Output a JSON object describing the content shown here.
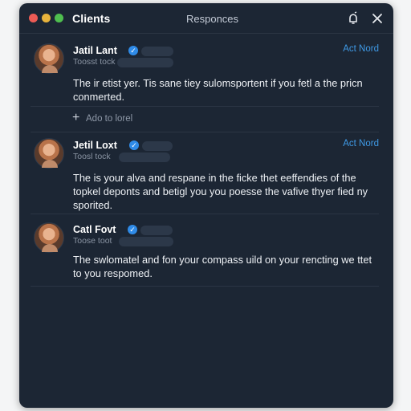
{
  "window": {
    "app_title": "Clients",
    "center_title": "Responces",
    "refresh_icon": "bell-icon",
    "close_icon": "close-icon"
  },
  "posts": [
    {
      "name": "Jatil Lant",
      "handle": "Toosst tock",
      "action": "Act Nord",
      "text": "The ir etist yer. Tis sane tiey sulomsportent if you fetl a the pricn conmerted."
    },
    {
      "name": "Jetil Loxt",
      "handle": "Toosl tock",
      "action": "Act Nord",
      "text": "The is your alva and respane in the ficke thet eeffendies of the topkel deponts and betigl you you poesse the vafive thyer fied ny sporited."
    },
    {
      "name": "Catl Fovt",
      "handle": "Toose toot",
      "action": "",
      "text": "The swlomatel and fon your compass uild on your rencting we ttet to you respomed."
    }
  ],
  "add_reply": {
    "label": "Ado to lorel"
  },
  "colors": {
    "window_bg": "#1c2634",
    "accent": "#3f9ae6",
    "verified": "#2f8be8"
  }
}
